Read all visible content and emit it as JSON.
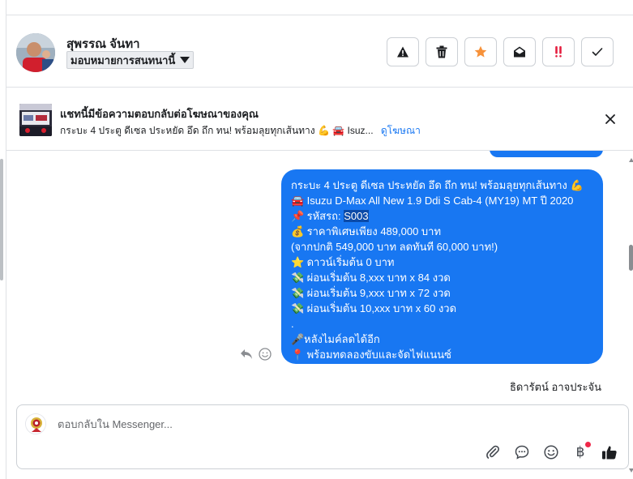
{
  "header": {
    "contact_name": "สุพรรณ จันทา",
    "assign_label": "มอบหมายการสนทนานี้",
    "toolbar": [
      {
        "icon": "warning-icon",
        "label": "Mark as spam"
      },
      {
        "icon": "trash-icon",
        "label": "Delete"
      },
      {
        "icon": "star-icon",
        "label": "Star",
        "color": "#f7923a"
      },
      {
        "icon": "envelope-open-icon",
        "label": "Mark as unread"
      },
      {
        "icon": "priority-icon",
        "label": "Mark as priority",
        "color": "#e41e3f"
      },
      {
        "icon": "check-icon",
        "label": "Mark as done"
      }
    ]
  },
  "ad_banner": {
    "title": "แชทนี้มีข้อความตอบกลับต่อโฆษณาของคุณ",
    "subtitle": "กระบะ 4 ประตู ดีเซล ประหยัด อึด ถึก ทน! พร้อมลุยทุกเส้นทาง 💪 🚘 Isuz...",
    "link_label": "ดูโฆษณา"
  },
  "message": {
    "lines": [
      {
        "emoji": "",
        "text": "กระบะ 4 ประตู ดีเซล ประหยัด อึด ถึก ทน! พร้อมลุยทุกเส้นทาง 💪"
      },
      {
        "emoji": "🚘",
        "text": " Isuzu D-Max All New 1.9 Ddi S Cab-4 (MY19) MT ปี 2020"
      },
      {
        "emoji": "📌",
        "text": " รหัสรถ: ",
        "highlight": "S003"
      },
      {
        "emoji": "💰",
        "text": " ราคาพิเศษเพียง 489,000 บาท"
      },
      {
        "emoji": "",
        "text": "(จากปกติ 549,000 บาท ลดทันที 60,000 บาท!)"
      },
      {
        "emoji": "⭐",
        "text": " ดาวน์เริ่มต้น 0 บาท"
      },
      {
        "emoji": "💸",
        "text": " ผ่อนเริ่มต้น 8,xxx บาท x 84 งวด"
      },
      {
        "emoji": "💸",
        "text": " ผ่อนเริ่มต้น 9,xxx บาท x 72 งวด"
      },
      {
        "emoji": "💸",
        "text": " ผ่อนเริ่มต้น 10,xxx บาท x 60 งวด"
      },
      {
        "emoji": "",
        "text": "."
      },
      {
        "emoji": "🎤",
        "text": "หลังไมค์ลดได้อีก"
      },
      {
        "emoji": "📍",
        "text": " พร้อมทดลองขับและจัดไฟแนนซ์"
      }
    ],
    "sender": "ธิดารัตน์ อาจประจัน"
  },
  "composer": {
    "placeholder": "ตอบกลับใน Messenger...",
    "actions": [
      "paperclip-icon",
      "speech-bubble-icon",
      "emoji-icon",
      "baht-icon",
      "thumbs-up-icon"
    ],
    "baht_symbol": "฿"
  },
  "colors": {
    "accent": "#1877f2",
    "border": "#ccd0d5",
    "text": "#1c1e21",
    "notification": "#f02849"
  }
}
